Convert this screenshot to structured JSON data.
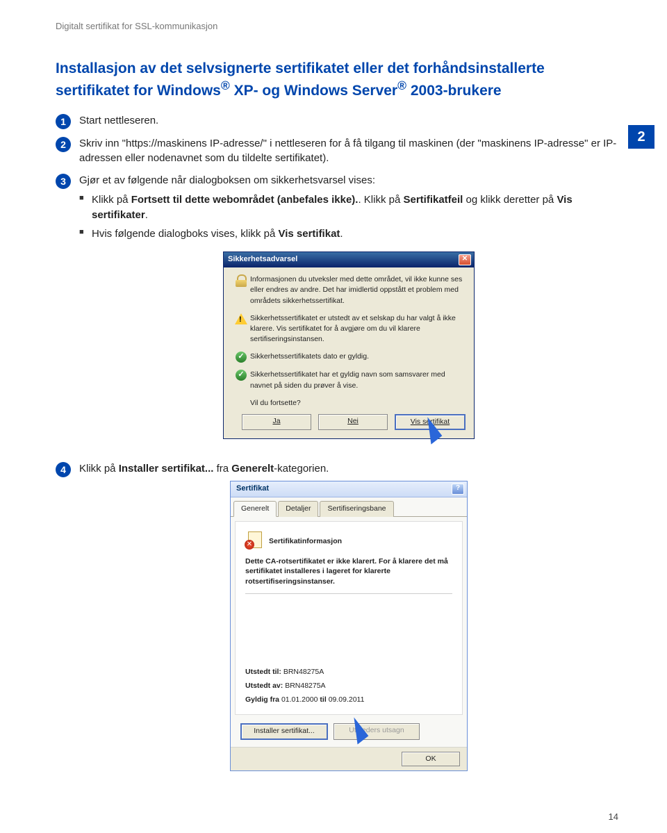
{
  "header": "Digitalt sertifikat for SSL-kommunikasjon",
  "title_l1": "Installasjon av det selvsignerte sertifikatet eller det forhåndsinstallerte",
  "title_l2_a": "sertifikatet for Windows",
  "title_l2_b": " XP- og Windows Server",
  "title_l2_c": " 2003-brukere",
  "side_page": "2",
  "steps": {
    "s1": "Start nettleseren.",
    "s2": "Skriv inn \"https://maskinens IP-adresse/\" i nettleseren for å få tilgang til maskinen (der \"maskinens IP-adresse\" er IP-adressen eller nodenavnet som du tildelte sertifikatet).",
    "s3": "Gjør et av følgende når dialogboksen om sikkerhetsvarsel vises:",
    "b1_a": "Klikk på ",
    "b1_b": "Fortsett til dette webområdet (anbefales ikke).",
    "b1_c": ". Klikk på ",
    "b1_d": "Sertifikatfeil",
    "b1_e": " og klikk deretter på ",
    "b1_f": "Vis sertifikater",
    "b1_g": ".",
    "b2_a": "Hvis følgende dialogboks vises, klikk på ",
    "b2_b": "Vis sertifikat",
    "b2_c": ".",
    "s4_a": "Klikk på ",
    "s4_b": "Installer sertifikat...",
    "s4_c": " fra ",
    "s4_d": "Generelt",
    "s4_e": "-kategorien."
  },
  "dlg1": {
    "title": "Sikkerhetsadvarsel",
    "intro": "Informasjonen du utveksler med dette området, vil ikke kunne ses eller endres av andre. Det har imidlertid oppstått et problem med områdets sikkerhetssertifikat.",
    "warn": "Sikkerhetssertifikatet er utstedt av et selskap du har valgt å ikke klarere. Vis sertifikatet for å avgjøre om du vil klarere sertifiseringsinstansen.",
    "ok1": "Sikkerhetssertifikatets dato er gyldig.",
    "ok2": "Sikkerhetssertifikatet har et gyldig navn som samsvarer med navnet på siden du prøver å vise.",
    "q": "Vil du fortsette?",
    "btn_yes": "Ja",
    "btn_no": "Nei",
    "btn_view": "Vis sertifikat"
  },
  "dlg2": {
    "title": "Sertifikat",
    "tab1": "Generelt",
    "tab2": "Detaljer",
    "tab3": "Sertifiseringsbane",
    "heading": "Sertifikatinformasjon",
    "warn": "Dette CA-rotsertifikatet er ikke klarert. For å klarere det må sertifikatet installeres i lageret for klarerte rotsertifiseringsinstanser.",
    "issued_to_l": "Utstedt til:",
    "issued_to_v": "BRN48275A",
    "issued_by_l": "Utstedt av:",
    "issued_by_v": "BRN48275A",
    "valid_l": "Gyldig fra",
    "valid_from": "01.01.2000",
    "valid_mid": "til",
    "valid_to": "09.09.2011",
    "btn_install": "Installer sertifikat...",
    "btn_issuer": "Utsteders utsagn",
    "btn_ok": "OK"
  },
  "page_number": "14"
}
